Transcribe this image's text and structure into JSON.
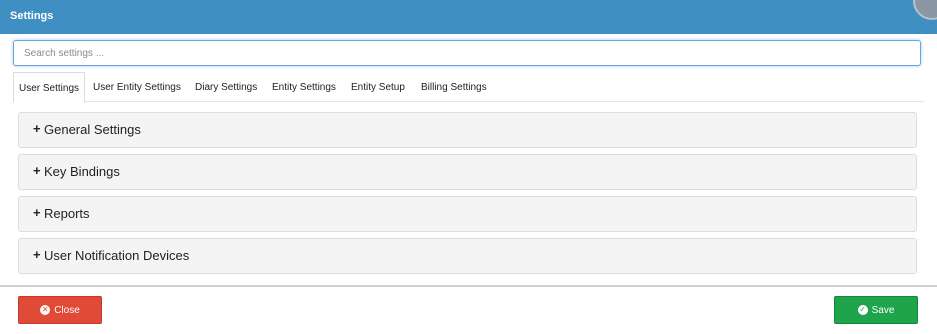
{
  "window": {
    "title": "Settings"
  },
  "search": {
    "placeholder": "Search settings ..."
  },
  "tabs": [
    {
      "label": "User Settings",
      "active": true
    },
    {
      "label": "User Entity Settings"
    },
    {
      "label": "Diary Settings"
    },
    {
      "label": "Entity Settings"
    },
    {
      "label": "Entity Setup"
    },
    {
      "label": "Billing Settings"
    }
  ],
  "panels": [
    {
      "label": "General Settings",
      "expand_symbol": "+"
    },
    {
      "label": "Key Bindings",
      "expand_symbol": "+"
    },
    {
      "label": "Reports",
      "expand_symbol": "+"
    },
    {
      "label": "User Notification Devices",
      "expand_symbol": "+"
    }
  ],
  "footer": {
    "close_label": "Close",
    "close_icon": "x-circle-icon",
    "save_label": "Save",
    "save_icon": "check-circle-icon"
  },
  "colors": {
    "titlebar": "#3f8fc3",
    "close_button": "#e04a37",
    "save_button": "#1ea54c"
  }
}
